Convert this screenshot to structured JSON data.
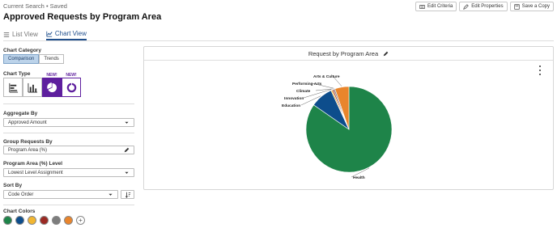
{
  "header": {
    "meta": "Current Search • Saved",
    "title": "Approved Requests by Program Area",
    "actions": [
      "Edit Criteria",
      "Edit Properties",
      "Save a Copy"
    ]
  },
  "tabs": {
    "list_view": "List View",
    "chart_view": "Chart View",
    "active": "Chart View"
  },
  "settings": {
    "chart_category_label": "Chart Category",
    "category_options": [
      "Comparison",
      "Trends"
    ],
    "category_selected": "Comparison",
    "chart_type_label": "Chart Type",
    "chart_type_icons": [
      "horizontal-bar-icon",
      "vertical-bar-icon",
      "pie-chart-icon",
      "donut-chart-icon"
    ],
    "chart_type_selected": "pie-chart-icon",
    "new_badge": "NEW!",
    "aggregate_by_label": "Aggregate By",
    "aggregate_by_value": "Approved Amount",
    "group_by_label": "Group Requests By",
    "group_by_value": "Program Area (%)",
    "level_label": "Program Area (%) Level",
    "level_value": "Lowest Level Assignment",
    "sort_by_label": "Sort By",
    "sort_by_value": "Code Order",
    "chart_colors_label": "Chart Colors",
    "colors": [
      "#1e8449",
      "#0d4d8c",
      "#f2b631",
      "#9b2a23",
      "#7d7d7d",
      "#e9852c"
    ]
  },
  "chart_panel": {
    "title": "Request by Program Area"
  },
  "chart_data": {
    "type": "pie",
    "title": "Request by Program Area",
    "categories": [
      "Health",
      "Education",
      "Innovation",
      "Climate",
      "Performing Arts",
      "Arts & Culture"
    ],
    "values": [
      80,
      8,
      0.5,
      0.5,
      0.5,
      5
    ],
    "colors": [
      "#1e8449",
      "#0d4d8c",
      "#f2b631",
      "#9b2a23",
      "#7d7d7d",
      "#e9852c"
    ]
  }
}
